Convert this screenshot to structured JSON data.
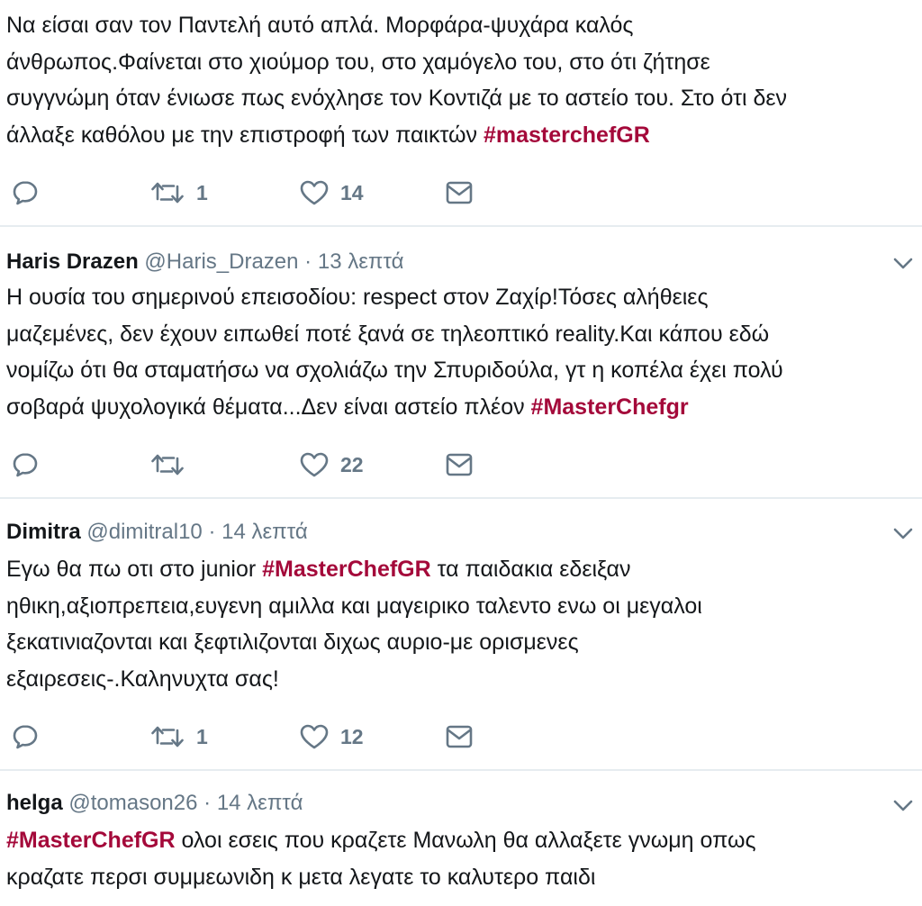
{
  "tweets": [
    {
      "author_name": "",
      "handle": "",
      "time": "",
      "lines": [
        [
          {
            "t": "Να είσαι σαν τον Παντελή αυτό απλά. Μορφάρα-ψυχάρα καλός"
          }
        ],
        [
          {
            "t": "άνθρωπος.Φαίνεται στο χιούμορ του, στο χαμόγελο του, στο ότι ζήτησε"
          }
        ],
        [
          {
            "t": "συγγνώμη όταν ένιωσε πως ενόχλησε τον Κοντιζά με το αστείο του. Στο ότι δεν"
          }
        ],
        [
          {
            "t": "άλλαξε καθόλου με την επιστροφή των παικτών "
          },
          {
            "t": "#masterchefGR",
            "tag": true
          }
        ]
      ],
      "retweets": "1",
      "likes": "14"
    },
    {
      "author_name": "Haris Drazen",
      "handle": "@Haris_Drazen",
      "time": "13 λεπτά",
      "lines": [
        [
          {
            "t": "Η ουσία του σημερινού επεισοδίου: respect στον Ζαχίρ!Τόσες αλήθειες"
          }
        ],
        [
          {
            "t": "μαζεμένες, δεν έχουν ειπωθεί ποτέ ξανά σε τηλεοπτικό reality.Και κάπου εδώ"
          }
        ],
        [
          {
            "t": "νομίζω ότι θα σταματήσω να σχολιάζω την Σπυριδούλα, γτ η κοπέλα έχει πολύ"
          }
        ],
        [
          {
            "t": "σοβαρά ψυχολογικά θέματα...Δεν είναι αστείο πλέον "
          },
          {
            "t": "#MasterChefgr",
            "tag": true
          }
        ]
      ],
      "retweets": "",
      "likes": "22"
    },
    {
      "author_name": "Dimitra",
      "handle": "@dimitral10",
      "time": "14 λεπτά",
      "lines": [
        [
          {
            "t": "Εγω θα πω οτι στο junior "
          },
          {
            "t": "#MasterChefGR",
            "tag": true
          },
          {
            "t": " τα παιδακια εδειξαν"
          }
        ],
        [
          {
            "t": "ηθικη,αξιοπρεπεια,ευγενη αμιλλα και μαγειρικο ταλεντο ενω οι μεγαλοι"
          }
        ],
        [
          {
            "t": "ξεκατινιαζονται και ξεφτιλιζονται διχως αυριο-με ορισμενες"
          }
        ],
        [
          {
            "t": "εξαιρεσεις-.Καληνυχτα σας!"
          }
        ]
      ],
      "retweets": "1",
      "likes": "12"
    },
    {
      "author_name": "helga",
      "handle": "@tomason26",
      "time": "14 λεπτά",
      "lines": [
        [
          {
            "t": "#MasterChefGR",
            "tag": true
          },
          {
            "t": " ολοι εσεις που κραζετε Μανωλη θα αλλαξετε γνωμη οπως"
          }
        ],
        [
          {
            "t": "κραζατε περσι συμμεωνιδη κ μετα λεγατε το καλυτερο παιδι"
          }
        ]
      ],
      "retweets": "",
      "likes": ""
    }
  ],
  "separator": "·",
  "icons": {
    "reply": "reply-icon",
    "retweet": "retweet-icon",
    "like": "heart-icon",
    "message": "envelope-icon",
    "more": "chevron-down-icon"
  },
  "colors": {
    "hashtag": "#a4093a",
    "secondary_text": "#657786",
    "divider": "#e6ecf0"
  }
}
